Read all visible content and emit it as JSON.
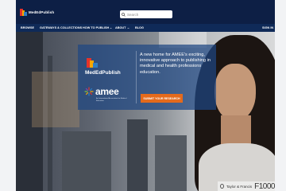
{
  "header": {
    "logo_text": "MedEdPublish",
    "search_placeholder": "Search"
  },
  "nav": {
    "items": [
      {
        "label": "BROWSE",
        "has_dropdown": false
      },
      {
        "label": "GATEWAYS & COLLECTIONS",
        "has_dropdown": false
      },
      {
        "label": "HOW TO PUBLISH",
        "has_dropdown": true
      },
      {
        "label": "ABOUT",
        "has_dropdown": true
      },
      {
        "label": "BLOG",
        "has_dropdown": false
      }
    ],
    "sign_in": "SIGN IN"
  },
  "hero": {
    "brand_name": "MedEdPublish",
    "partner_name": "amee",
    "partner_tagline": "An International Association for Medical Education",
    "headline": "A new home for AMEE's exciting, innovative approach to publishing in medical and health professions education.",
    "cta_label": "SUBMIT YOUR RESEARCH"
  },
  "footer": {
    "publisher": "Taylor & Francis",
    "platform": "F1000"
  },
  "colors": {
    "header_bg": "#0d1f45",
    "nav_bg": "#0f2a58",
    "panel_bg": "#1e4682",
    "cta_bg": "#e46a1c"
  }
}
